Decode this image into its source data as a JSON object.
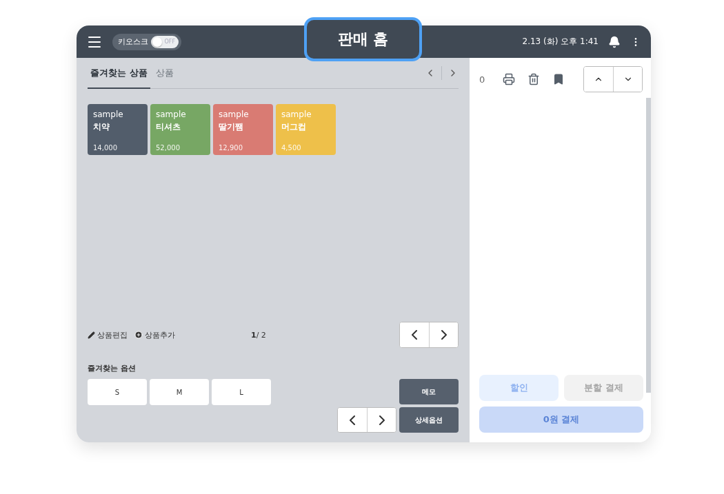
{
  "header": {
    "kiosk": {
      "label": "키오스크",
      "on": false,
      "state_label": "OFF"
    },
    "title": "판매 홈",
    "datetime": "2.13 (화) 오후 1:41"
  },
  "tabs": [
    {
      "label": "즐겨찾는 상품",
      "selected": true
    },
    {
      "label": "상품",
      "selected": false
    }
  ],
  "products": [
    {
      "name": "sample",
      "subname": "치약",
      "price": "14,000",
      "color": "#525d6b"
    },
    {
      "name": "sample",
      "subname": "티셔츠",
      "price": "52,000",
      "color": "#77a764"
    },
    {
      "name": "sample",
      "subname": "딸기쨈",
      "price": "12,900",
      "color": "#d97b73"
    },
    {
      "name": "sample",
      "subname": "머그컵",
      "price": "4,500",
      "color": "#eec04a"
    }
  ],
  "product_actions": [
    "상품편집",
    "상품추가"
  ],
  "page": {
    "current": "1",
    "total": "/ 2"
  },
  "options": {
    "title": "즐겨찾는 옵션",
    "items": [
      "S",
      "M",
      "L"
    ]
  },
  "side_buttons": [
    "메모",
    "상세옵션"
  ],
  "cart": {
    "count": "0"
  },
  "payment": [
    {
      "label": "할인",
      "kind": "discount",
      "disabled": true
    },
    {
      "label": "분할 결제",
      "kind": "split",
      "disabled": true
    },
    {
      "label": "0원 결제",
      "kind": "pay",
      "disabled": true
    }
  ]
}
